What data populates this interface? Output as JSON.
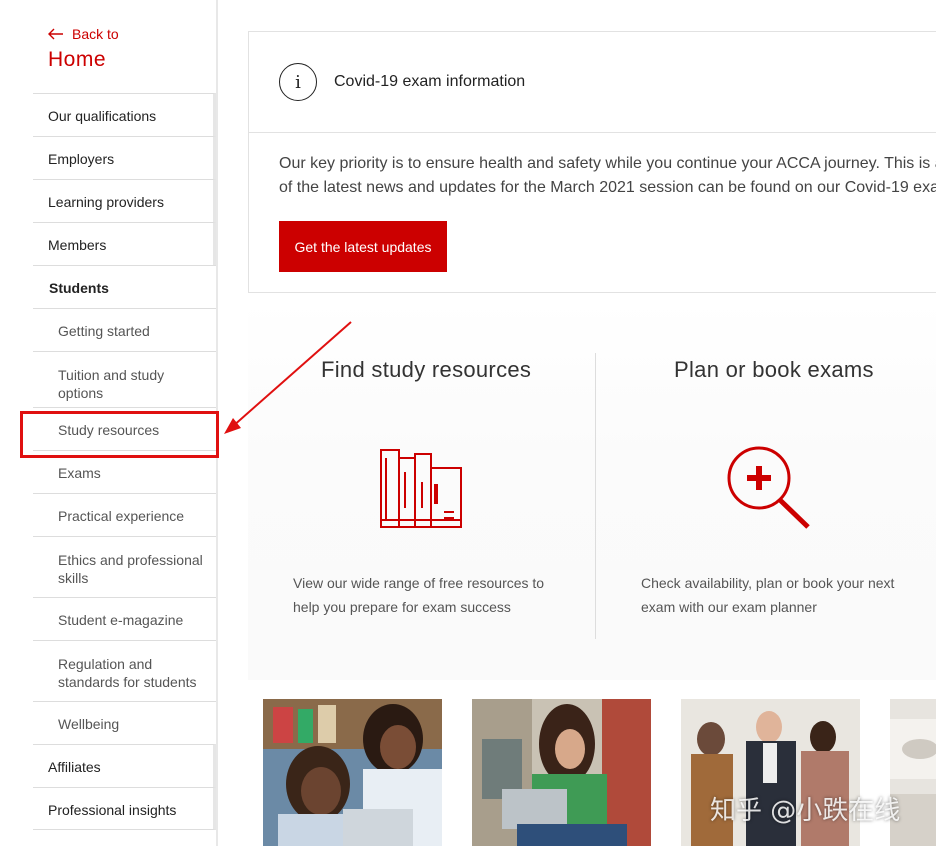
{
  "sidebar": {
    "back_label": "Back to",
    "home_label": "Home",
    "items": [
      {
        "label": "Our qualifications"
      },
      {
        "label": "Employers"
      },
      {
        "label": "Learning providers"
      },
      {
        "label": "Members"
      },
      {
        "label": "Students"
      },
      {
        "label": "Getting started"
      },
      {
        "label": "Tuition and study options"
      },
      {
        "label": "Study resources"
      },
      {
        "label": "Exams"
      },
      {
        "label": "Practical experience"
      },
      {
        "label": "Ethics and professional skills"
      },
      {
        "label": "Student e-magazine"
      },
      {
        "label": "Regulation and standards for students"
      },
      {
        "label": "Wellbeing"
      },
      {
        "label": "Affiliates"
      },
      {
        "label": "Professional insights"
      }
    ]
  },
  "covid": {
    "title": "Covid-19 exam information",
    "line1": "Our key priority is to ensure health and safety while you continue your ACCA journey. This is a",
    "line2": "of the latest news and updates for the March 2021 session can be found on our Covid-19 exa",
    "button": "Get the latest updates"
  },
  "features": [
    {
      "title": "Find study resources",
      "line1": "View our wide range of free resources to",
      "line2": "help you prepare for exam success",
      "icon": "books-icon"
    },
    {
      "title": "Plan or book exams",
      "line1": "Check availability, plan or book your next",
      "line2": "exam with our exam planner",
      "icon": "magnifier-plus-icon"
    }
  ],
  "watermark": "知乎 @小跌在线",
  "colors": {
    "brand": "#cc0000",
    "annotation": "#e01010"
  }
}
